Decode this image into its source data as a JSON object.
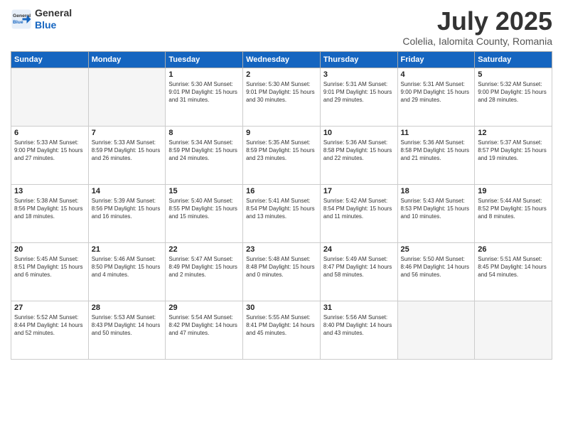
{
  "header": {
    "logo_general": "General",
    "logo_blue": "Blue",
    "month": "July 2025",
    "location": "Colelia, Ialomita County, Romania"
  },
  "weekdays": [
    "Sunday",
    "Monday",
    "Tuesday",
    "Wednesday",
    "Thursday",
    "Friday",
    "Saturday"
  ],
  "weeks": [
    [
      {
        "day": "",
        "info": ""
      },
      {
        "day": "",
        "info": ""
      },
      {
        "day": "1",
        "info": "Sunrise: 5:30 AM\nSunset: 9:01 PM\nDaylight: 15 hours and 31 minutes."
      },
      {
        "day": "2",
        "info": "Sunrise: 5:30 AM\nSunset: 9:01 PM\nDaylight: 15 hours and 30 minutes."
      },
      {
        "day": "3",
        "info": "Sunrise: 5:31 AM\nSunset: 9:01 PM\nDaylight: 15 hours and 29 minutes."
      },
      {
        "day": "4",
        "info": "Sunrise: 5:31 AM\nSunset: 9:00 PM\nDaylight: 15 hours and 29 minutes."
      },
      {
        "day": "5",
        "info": "Sunrise: 5:32 AM\nSunset: 9:00 PM\nDaylight: 15 hours and 28 minutes."
      }
    ],
    [
      {
        "day": "6",
        "info": "Sunrise: 5:33 AM\nSunset: 9:00 PM\nDaylight: 15 hours and 27 minutes."
      },
      {
        "day": "7",
        "info": "Sunrise: 5:33 AM\nSunset: 8:59 PM\nDaylight: 15 hours and 26 minutes."
      },
      {
        "day": "8",
        "info": "Sunrise: 5:34 AM\nSunset: 8:59 PM\nDaylight: 15 hours and 24 minutes."
      },
      {
        "day": "9",
        "info": "Sunrise: 5:35 AM\nSunset: 8:59 PM\nDaylight: 15 hours and 23 minutes."
      },
      {
        "day": "10",
        "info": "Sunrise: 5:36 AM\nSunset: 8:58 PM\nDaylight: 15 hours and 22 minutes."
      },
      {
        "day": "11",
        "info": "Sunrise: 5:36 AM\nSunset: 8:58 PM\nDaylight: 15 hours and 21 minutes."
      },
      {
        "day": "12",
        "info": "Sunrise: 5:37 AM\nSunset: 8:57 PM\nDaylight: 15 hours and 19 minutes."
      }
    ],
    [
      {
        "day": "13",
        "info": "Sunrise: 5:38 AM\nSunset: 8:56 PM\nDaylight: 15 hours and 18 minutes."
      },
      {
        "day": "14",
        "info": "Sunrise: 5:39 AM\nSunset: 8:56 PM\nDaylight: 15 hours and 16 minutes."
      },
      {
        "day": "15",
        "info": "Sunrise: 5:40 AM\nSunset: 8:55 PM\nDaylight: 15 hours and 15 minutes."
      },
      {
        "day": "16",
        "info": "Sunrise: 5:41 AM\nSunset: 8:54 PM\nDaylight: 15 hours and 13 minutes."
      },
      {
        "day": "17",
        "info": "Sunrise: 5:42 AM\nSunset: 8:54 PM\nDaylight: 15 hours and 11 minutes."
      },
      {
        "day": "18",
        "info": "Sunrise: 5:43 AM\nSunset: 8:53 PM\nDaylight: 15 hours and 10 minutes."
      },
      {
        "day": "19",
        "info": "Sunrise: 5:44 AM\nSunset: 8:52 PM\nDaylight: 15 hours and 8 minutes."
      }
    ],
    [
      {
        "day": "20",
        "info": "Sunrise: 5:45 AM\nSunset: 8:51 PM\nDaylight: 15 hours and 6 minutes."
      },
      {
        "day": "21",
        "info": "Sunrise: 5:46 AM\nSunset: 8:50 PM\nDaylight: 15 hours and 4 minutes."
      },
      {
        "day": "22",
        "info": "Sunrise: 5:47 AM\nSunset: 8:49 PM\nDaylight: 15 hours and 2 minutes."
      },
      {
        "day": "23",
        "info": "Sunrise: 5:48 AM\nSunset: 8:48 PM\nDaylight: 15 hours and 0 minutes."
      },
      {
        "day": "24",
        "info": "Sunrise: 5:49 AM\nSunset: 8:47 PM\nDaylight: 14 hours and 58 minutes."
      },
      {
        "day": "25",
        "info": "Sunrise: 5:50 AM\nSunset: 8:46 PM\nDaylight: 14 hours and 56 minutes."
      },
      {
        "day": "26",
        "info": "Sunrise: 5:51 AM\nSunset: 8:45 PM\nDaylight: 14 hours and 54 minutes."
      }
    ],
    [
      {
        "day": "27",
        "info": "Sunrise: 5:52 AM\nSunset: 8:44 PM\nDaylight: 14 hours and 52 minutes."
      },
      {
        "day": "28",
        "info": "Sunrise: 5:53 AM\nSunset: 8:43 PM\nDaylight: 14 hours and 50 minutes."
      },
      {
        "day": "29",
        "info": "Sunrise: 5:54 AM\nSunset: 8:42 PM\nDaylight: 14 hours and 47 minutes."
      },
      {
        "day": "30",
        "info": "Sunrise: 5:55 AM\nSunset: 8:41 PM\nDaylight: 14 hours and 45 minutes."
      },
      {
        "day": "31",
        "info": "Sunrise: 5:56 AM\nSunset: 8:40 PM\nDaylight: 14 hours and 43 minutes."
      },
      {
        "day": "",
        "info": ""
      },
      {
        "day": "",
        "info": ""
      }
    ]
  ]
}
